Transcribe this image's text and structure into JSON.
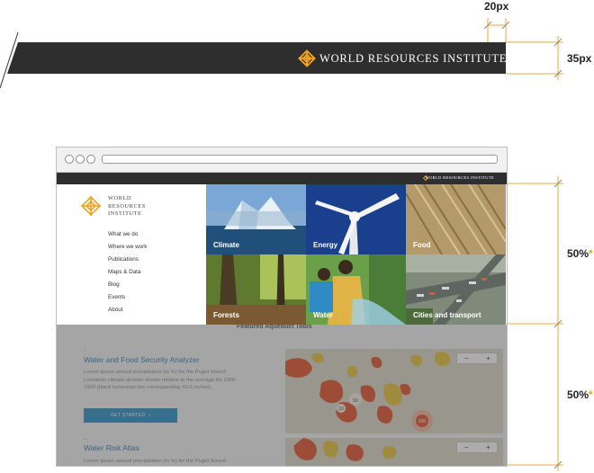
{
  "spec": {
    "gap_label": "20px",
    "height_label": "35px",
    "top_half_label": "50%",
    "bottom_half_label": "50%",
    "asterisk": "*",
    "banner_brand": "WORLD RESOURCES INSTITUTE"
  },
  "browser": {
    "header_brand": "WORLD RESOURCES INSTITUTE",
    "logo_text": [
      "WORLD",
      "RESOURCES",
      "INSTITUTE"
    ],
    "nav": [
      "What we do",
      "Where we work",
      "Publications",
      "Maps & Data",
      "Blog",
      "Events",
      "About"
    ],
    "tiles": [
      "Climate",
      "Energy",
      "Food",
      "Forests",
      "Water",
      "Cities and transport"
    ],
    "featured_title": "Featured Aqueduct Tools",
    "tool1": {
      "title": "Water and Food Security Analyzer",
      "description": "Lorem ipsum annual precipitation (in %) for the Puget Sound Lowlands climate division shown relative to the average for 1950-1999 (black horizontal line corresponding 43.6 inches).",
      "button": "GET STARTED",
      "button_arrow": "›"
    },
    "tool2": {
      "title": "Water Risk Atlas",
      "description": "Lorem ipsum annual precipitation (in %) for the Puget Sound"
    },
    "map_labels": [
      "50",
      "10",
      "200"
    ],
    "zoom": {
      "minus": "−",
      "plus": "+"
    }
  },
  "colors": {
    "accent": "#f0a21e",
    "header": "#2e2e2e",
    "link": "#2f7fb9"
  }
}
